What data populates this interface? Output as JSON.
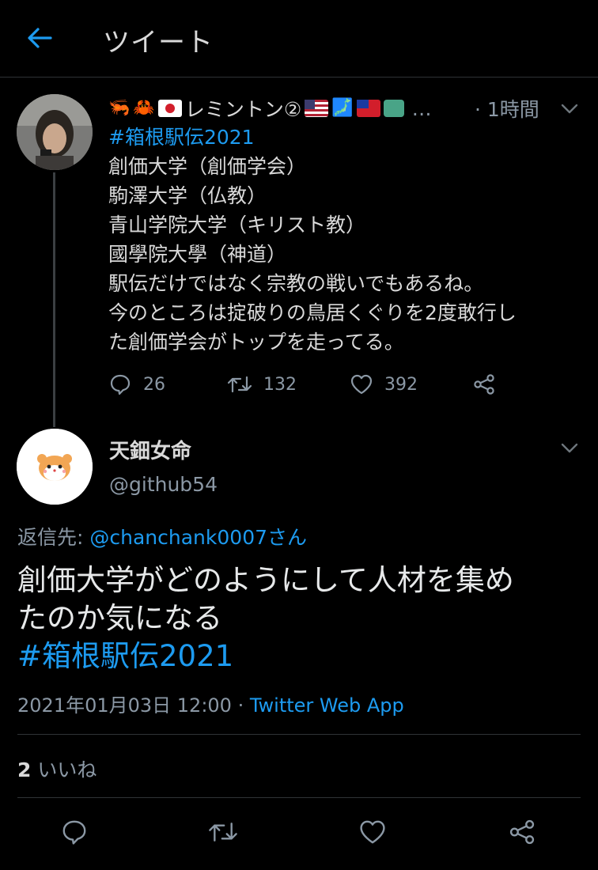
{
  "header": {
    "title": "ツイート"
  },
  "parent_tweet": {
    "display_name": "レミントン②",
    "emoji_prefix": [
      "🦐",
      "🦀"
    ],
    "emoji_suffix": [
      "🗾"
    ],
    "ellipsis": "…",
    "time": "· 1時間",
    "hashtag": "#箱根駅伝2021",
    "lines": [
      "創価大学（創価学会）",
      "駒澤大学（仏教）",
      "青山学院大学（キリスト教）",
      "國學院大學（神道）",
      "駅伝だけではなく宗教の戦いでもあるね。",
      "今のところは掟破りの鳥居くぐりを2度敢行し",
      "た創価学会がトップを走ってる。"
    ],
    "reply_count": "26",
    "retweet_count": "132",
    "like_count": "392"
  },
  "focused_tweet": {
    "display_name": "天鈿女命",
    "handle": "@github54",
    "reply_to_label": "返信先:",
    "reply_to_mention": "@chanchank0007さん",
    "text_lines": [
      "創価大学がどのようにして人材を集め",
      "たのか気になる"
    ],
    "hashtag": "#箱根駅伝2021",
    "timestamp": "2021年01月03日 12:00 ·",
    "source": "Twitter Web App",
    "likes_count": "2",
    "likes_label": "いいね"
  },
  "colors": {
    "background": "#000000",
    "text": "#d9d9d9",
    "muted": "#8b98a5",
    "accent": "#1d9bf0",
    "divider": "#2f3336"
  }
}
